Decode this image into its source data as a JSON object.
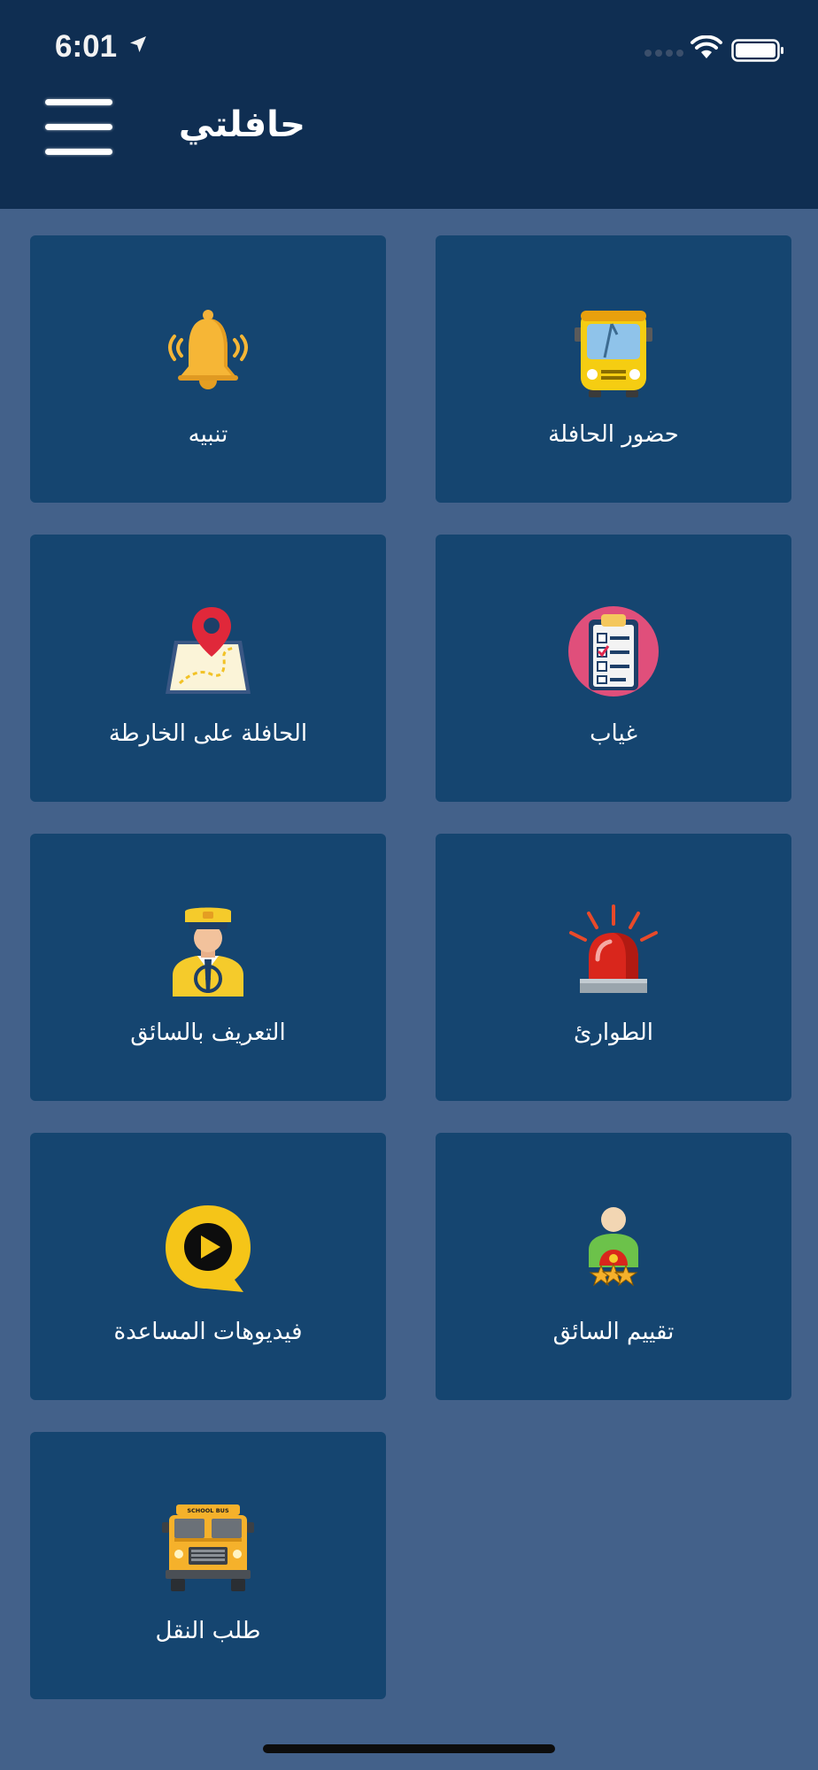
{
  "status_bar": {
    "time": "6:01"
  },
  "header": {
    "title": "حافلتي"
  },
  "tiles": [
    {
      "label": "حضور الحافلة",
      "icon": "bus-front-icon"
    },
    {
      "label": "تنبيه",
      "icon": "bell-icon"
    },
    {
      "label": "غياب",
      "icon": "clipboard-checklist-icon"
    },
    {
      "label": "الحافلة على الخارطة",
      "icon": "map-pin-icon"
    },
    {
      "label": "الطوارئ",
      "icon": "siren-icon"
    },
    {
      "label": "التعريف بالسائق",
      "icon": "driver-icon"
    },
    {
      "label": "تقييم السائق",
      "icon": "rating-stars-icon"
    },
    {
      "label": "فيديوهات المساعدة",
      "icon": "play-video-icon"
    },
    {
      "label": "طلب النقل",
      "icon": "school-bus-icon"
    },
    {
      "label": "SCHOOL BUS",
      "icon": "school-bus-sign"
    }
  ],
  "colors": {
    "header": "#0f2e52",
    "background": "#43618a",
    "tile": "#154570"
  }
}
